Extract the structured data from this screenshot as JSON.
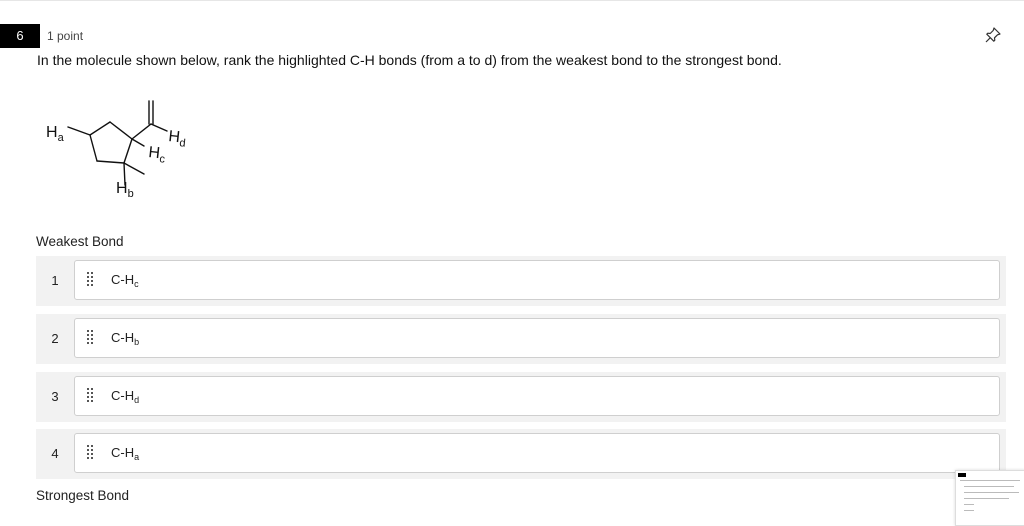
{
  "question": {
    "number": "6",
    "points": "1 point",
    "text": "In the molecule shown below, rank the highlighted C-H bonds (from a to d) from the weakest bond to the strongest bond."
  },
  "molecule": {
    "labels": {
      "a": {
        "h": "H",
        "sub": "a"
      },
      "b": {
        "h": "H",
        "sub": "b"
      },
      "c": {
        "h": "H",
        "sub": "c"
      },
      "d": {
        "h": "H",
        "sub": "d"
      }
    }
  },
  "ranking": {
    "top_label": "Weakest Bond",
    "bottom_label": "Strongest Bond",
    "items": [
      {
        "rank": "1",
        "bond": "C-H",
        "sub": "c"
      },
      {
        "rank": "2",
        "bond": "C-H",
        "sub": "b"
      },
      {
        "rank": "3",
        "bond": "C-H",
        "sub": "d"
      },
      {
        "rank": "4",
        "bond": "C-H",
        "sub": "a"
      }
    ]
  },
  "icons": {
    "pin": "pin-icon",
    "drag": "drag-handle-icon"
  }
}
